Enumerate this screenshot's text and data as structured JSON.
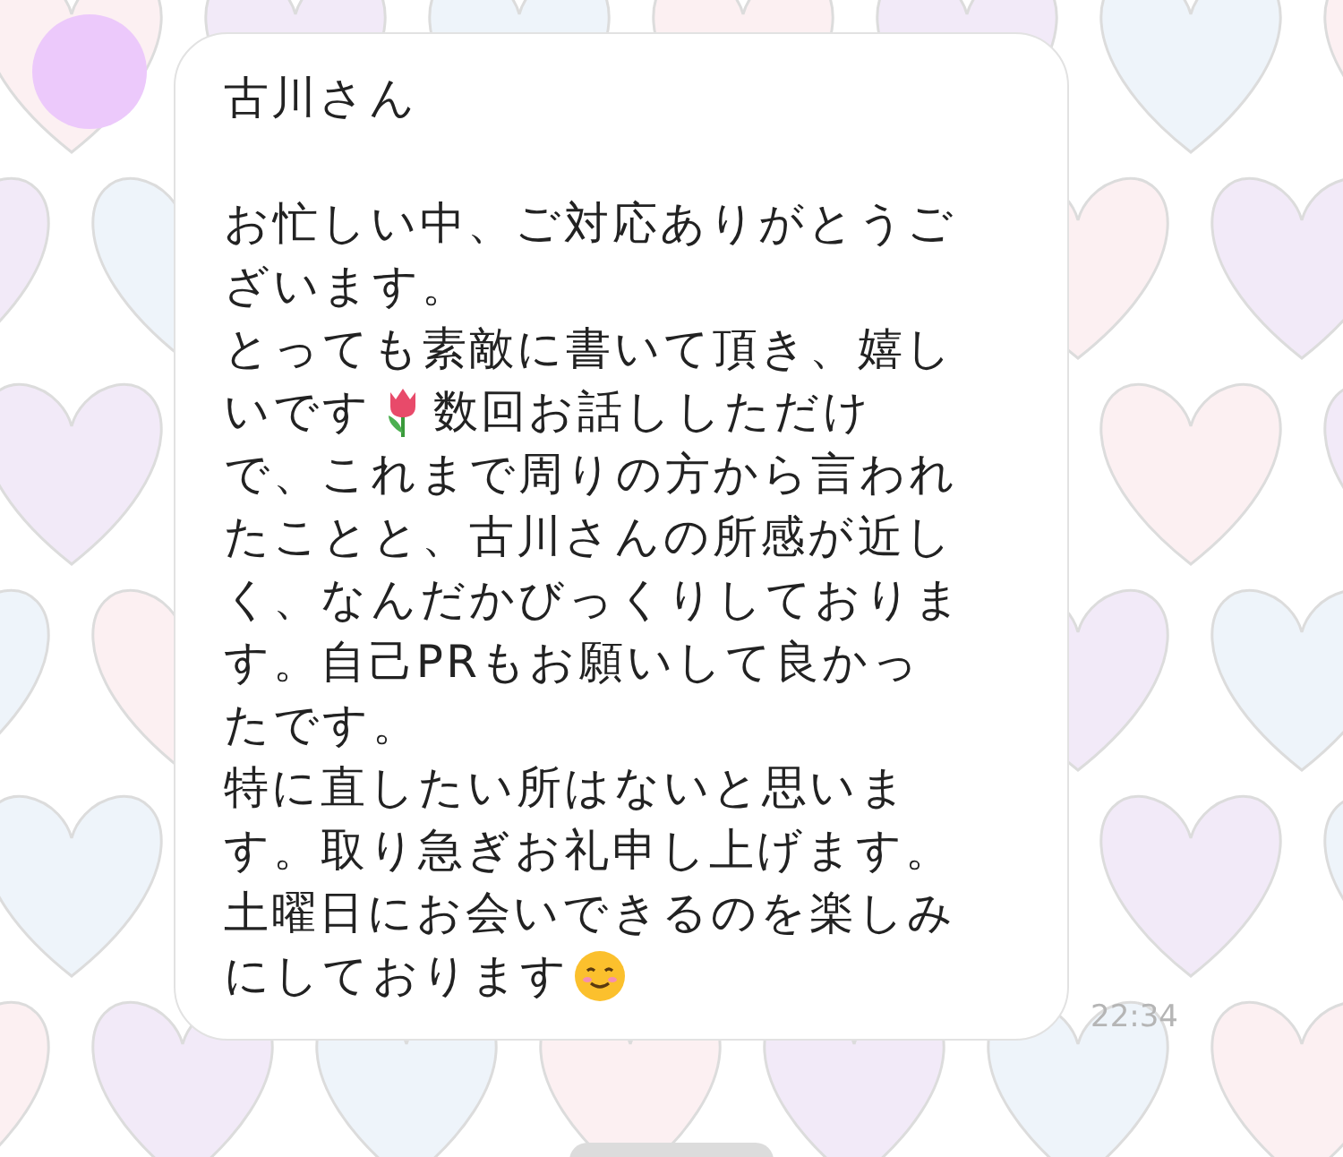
{
  "message": {
    "greeting": "古川さん",
    "lines": [
      {
        "parts": [
          {
            "kind": "text",
            "text": "お忙しい中、ご対応ありがとうご"
          }
        ]
      },
      {
        "parts": [
          {
            "kind": "text",
            "text": "ざいます。"
          }
        ]
      },
      {
        "parts": [
          {
            "kind": "text",
            "text": "とっても素敵に書いて頂き、嬉し"
          }
        ]
      },
      {
        "parts": [
          {
            "kind": "text",
            "text": "いです"
          },
          {
            "kind": "tulip"
          },
          {
            "kind": "text",
            "text": "数回お話ししただけ"
          }
        ]
      },
      {
        "parts": [
          {
            "kind": "text",
            "text": "で、これまで周りの方から言われ"
          }
        ]
      },
      {
        "parts": [
          {
            "kind": "text",
            "text": "たことと、古川さんの所感が近し"
          }
        ]
      },
      {
        "parts": [
          {
            "kind": "text",
            "text": "く、なんだかびっくりしておりま"
          }
        ]
      },
      {
        "parts": [
          {
            "kind": "text",
            "text": "す。自己PRもお願いして良かっ"
          }
        ]
      },
      {
        "parts": [
          {
            "kind": "text",
            "text": "たです。"
          }
        ]
      },
      {
        "parts": [
          {
            "kind": "text",
            "text": "特に直したい所はないと思いま"
          }
        ]
      },
      {
        "parts": [
          {
            "kind": "text",
            "text": "す。取り急ぎお礼申し上げます。"
          }
        ]
      },
      {
        "parts": [
          {
            "kind": "text",
            "text": "土曜日にお会いできるのを楽しみ"
          }
        ]
      },
      {
        "parts": [
          {
            "kind": "text",
            "text": "にしております"
          },
          {
            "kind": "smile"
          }
        ]
      }
    ],
    "time": "22:34"
  }
}
